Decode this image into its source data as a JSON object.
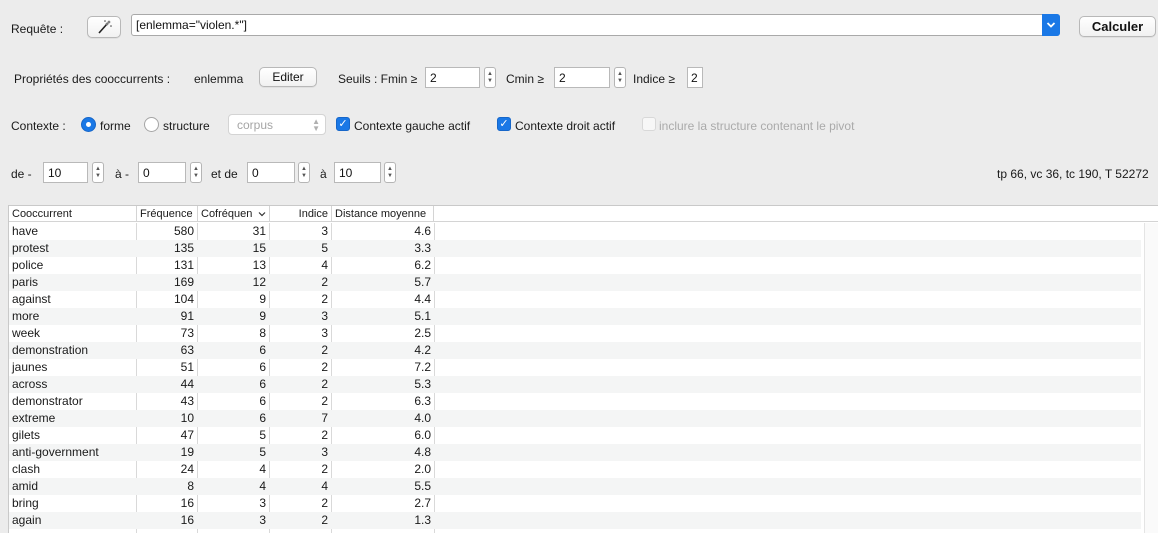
{
  "query": {
    "label": "Requête :",
    "value": "[enlemma=\"violen.*\"]",
    "calc_button": "Calculer"
  },
  "props": {
    "label": "Propriétés des cooccurrents :",
    "property": "enlemma",
    "edit_button": "Editer",
    "seuils_label": "Seuils : Fmin ≥",
    "fmin": "2",
    "cmin_label": "Cmin ≥",
    "cmin": "2",
    "indice_label": "Indice ≥",
    "indice": "2"
  },
  "context": {
    "label": "Contexte :",
    "forme": "forme",
    "structure": "structure",
    "structure_select": "corpus",
    "left_active": "Contexte gauche actif",
    "right_active": "Contexte droit actif",
    "include_structure": "inclure la structure contenant le pivot"
  },
  "range": {
    "de_label": "de -",
    "de_value": "10",
    "a_label": "à -",
    "a_value": "0",
    "et_de_label": "et de",
    "et_de_value": "0",
    "a2_label": "à",
    "a2_value": "10",
    "stats": "tp 66, vc 36, tc 190, T 52272"
  },
  "table": {
    "headers": {
      "cooccurrent": "Cooccurrent",
      "frequence": "Fréquence",
      "cofrequence": "Cofréquen",
      "indice": "Indice",
      "distance": "Distance moyenne"
    },
    "rows": [
      {
        "word": "have",
        "freq": "580",
        "cofreq": "31",
        "indice": "3",
        "dist": "4.6"
      },
      {
        "word": "protest",
        "freq": "135",
        "cofreq": "15",
        "indice": "5",
        "dist": "3.3"
      },
      {
        "word": "police",
        "freq": "131",
        "cofreq": "13",
        "indice": "4",
        "dist": "6.2"
      },
      {
        "word": "paris",
        "freq": "169",
        "cofreq": "12",
        "indice": "2",
        "dist": "5.7"
      },
      {
        "word": "against",
        "freq": "104",
        "cofreq": "9",
        "indice": "2",
        "dist": "4.4"
      },
      {
        "word": "more",
        "freq": "91",
        "cofreq": "9",
        "indice": "3",
        "dist": "5.1"
      },
      {
        "word": "week",
        "freq": "73",
        "cofreq": "8",
        "indice": "3",
        "dist": "2.5"
      },
      {
        "word": "demonstration",
        "freq": "63",
        "cofreq": "6",
        "indice": "2",
        "dist": "4.2"
      },
      {
        "word": "jaunes",
        "freq": "51",
        "cofreq": "6",
        "indice": "2",
        "dist": "7.2"
      },
      {
        "word": "across",
        "freq": "44",
        "cofreq": "6",
        "indice": "2",
        "dist": "5.3"
      },
      {
        "word": "demonstrator",
        "freq": "43",
        "cofreq": "6",
        "indice": "2",
        "dist": "6.3"
      },
      {
        "word": "extreme",
        "freq": "10",
        "cofreq": "6",
        "indice": "7",
        "dist": "4.0"
      },
      {
        "word": "gilets",
        "freq": "47",
        "cofreq": "5",
        "indice": "2",
        "dist": "6.0"
      },
      {
        "word": "anti-government",
        "freq": "19",
        "cofreq": "5",
        "indice": "3",
        "dist": "4.8"
      },
      {
        "word": "clash",
        "freq": "24",
        "cofreq": "4",
        "indice": "2",
        "dist": "2.0"
      },
      {
        "word": "amid",
        "freq": "8",
        "cofreq": "4",
        "indice": "4",
        "dist": "5.5"
      },
      {
        "word": "bring",
        "freq": "16",
        "cofreq": "3",
        "indice": "2",
        "dist": "2.7"
      },
      {
        "word": "again",
        "freq": "16",
        "cofreq": "3",
        "indice": "2",
        "dist": "1.3"
      }
    ]
  },
  "colors": {
    "accent": "#1a78e6",
    "window_bg": "#ececec",
    "row_alt": "#f4f5f5"
  }
}
